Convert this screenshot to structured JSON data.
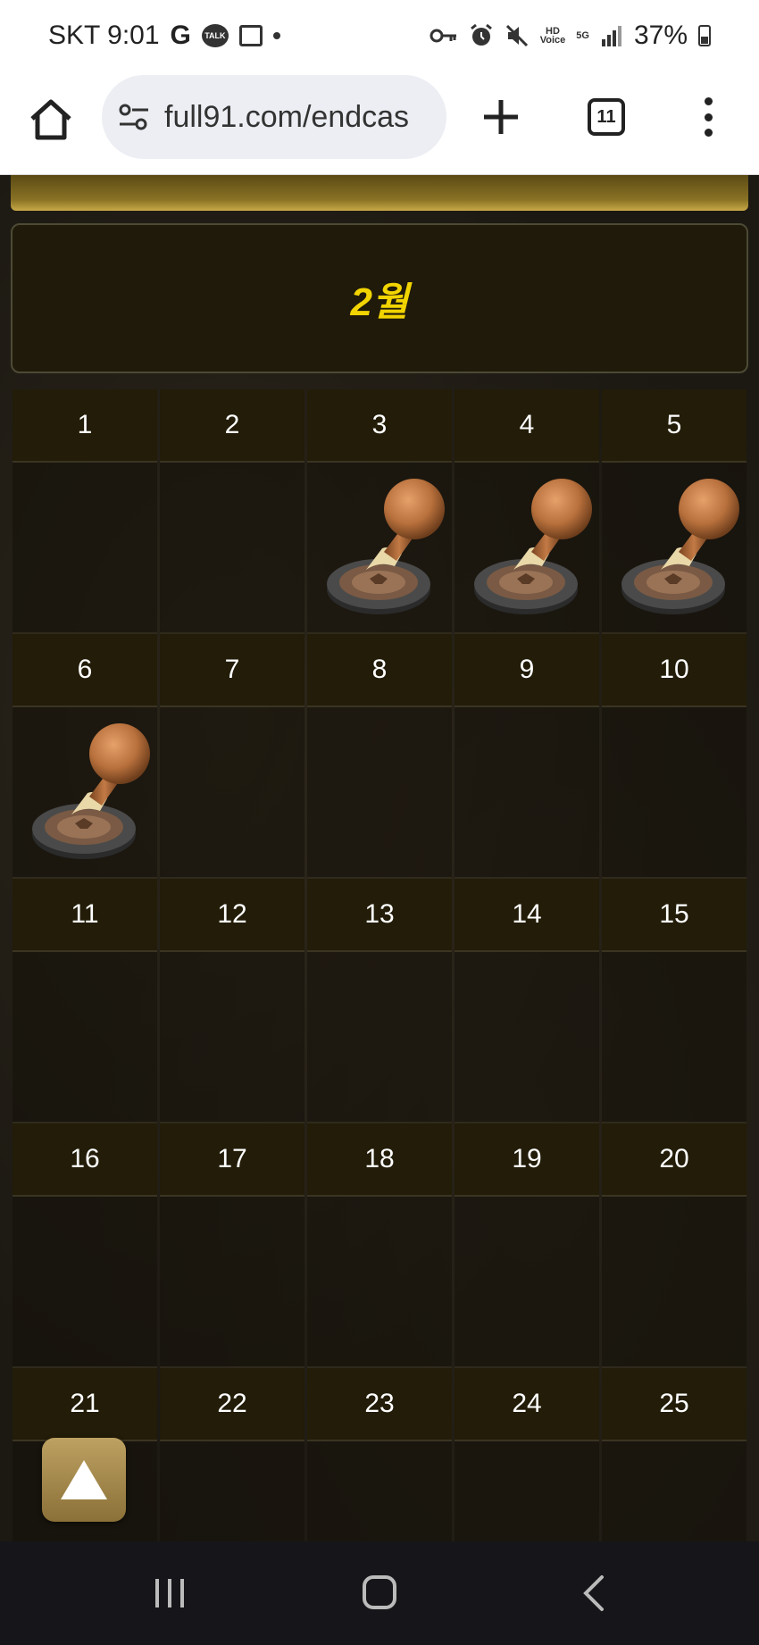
{
  "status_bar": {
    "carrier_time": "SKT 9:01",
    "battery": "37%",
    "icons": [
      "google-icon",
      "kakaotalk-icon",
      "gallery-icon",
      "dot-icon",
      "key-icon",
      "alarm-icon",
      "mute-icon",
      "hd-voice-icon",
      "5g-icon",
      "signal-icon",
      "battery-icon"
    ],
    "talk_label": "TALK",
    "hd_label": "HD",
    "voice_label": "Voice",
    "g5_label": "5G"
  },
  "browser": {
    "url": "full91.com/endcas",
    "tab_count": "11"
  },
  "calendar": {
    "month_title": "2월",
    "accent_color": "#f2d400",
    "weeks": [
      {
        "days": [
          {
            "day": "1",
            "stamped": false
          },
          {
            "day": "2",
            "stamped": false
          },
          {
            "day": "3",
            "stamped": true
          },
          {
            "day": "4",
            "stamped": true
          },
          {
            "day": "5",
            "stamped": true
          }
        ]
      },
      {
        "days": [
          {
            "day": "6",
            "stamped": true
          },
          {
            "day": "7",
            "stamped": false
          },
          {
            "day": "8",
            "stamped": false
          },
          {
            "day": "9",
            "stamped": false
          },
          {
            "day": "10",
            "stamped": false
          }
        ]
      },
      {
        "days": [
          {
            "day": "11",
            "stamped": false
          },
          {
            "day": "12",
            "stamped": false
          },
          {
            "day": "13",
            "stamped": false
          },
          {
            "day": "14",
            "stamped": false
          },
          {
            "day": "15",
            "stamped": false
          }
        ]
      },
      {
        "days": [
          {
            "day": "16",
            "stamped": false
          },
          {
            "day": "17",
            "stamped": false
          },
          {
            "day": "18",
            "stamped": false
          },
          {
            "day": "19",
            "stamped": false
          },
          {
            "day": "20",
            "stamped": false
          }
        ]
      },
      {
        "days": [
          {
            "day": "21",
            "stamped": false
          },
          {
            "day": "22",
            "stamped": false
          },
          {
            "day": "23",
            "stamped": false
          },
          {
            "day": "24",
            "stamped": false
          },
          {
            "day": "25",
            "stamped": false
          }
        ]
      }
    ]
  },
  "scroll_top_icon": "triangle-up-icon"
}
